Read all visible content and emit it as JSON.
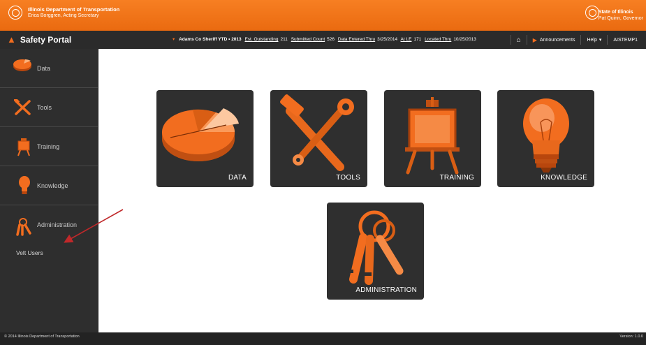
{
  "banner": {
    "org_name": "Illinois Department of Transportation",
    "org_sub": "Erica Borggren, Acting Secretary",
    "state_name": "State of Illinois",
    "state_sub": "Pat Quinn, Governor"
  },
  "navbar": {
    "brand": "Safety Portal",
    "agency": "Adams Co Sheriff YTD • 2013",
    "stats": [
      {
        "label": "Est. Outstanding",
        "value": "211"
      },
      {
        "label": "Submitted Count",
        "value": "526"
      },
      {
        "label": "Data Entered Thru",
        "value": "3/25/2014"
      },
      {
        "label": "At LE",
        "value": "171"
      },
      {
        "label": "Located Thru",
        "value": "10/25/2013"
      }
    ],
    "announcements": "Announcements",
    "help": "Help",
    "user": "AISTEMP1"
  },
  "sidebar": {
    "items": [
      {
        "label": "Data",
        "icon": "pie-chart-icon"
      },
      {
        "label": "Tools",
        "icon": "tools-icon"
      },
      {
        "label": "Training",
        "icon": "easel-icon"
      },
      {
        "label": "Knowledge",
        "icon": "lightbulb-icon"
      },
      {
        "label": "Administration",
        "icon": "keys-icon"
      }
    ],
    "subitem": "Velt Users"
  },
  "tiles": [
    {
      "label": "DATA",
      "icon": "pie-chart-icon"
    },
    {
      "label": "TOOLS",
      "icon": "tools-icon"
    },
    {
      "label": "TRAINING",
      "icon": "easel-icon"
    },
    {
      "label": "KNOWLEDGE",
      "icon": "lightbulb-icon"
    },
    {
      "label": "ADMINISTRATION",
      "icon": "keys-icon"
    }
  ],
  "footer": {
    "copyright": "© 2014 Illinois Department of Transportation",
    "version": "Version: 1.0.0"
  },
  "colors": {
    "accent": "#f26d1f",
    "banner": "#ee7016",
    "dark": "#2e2e2e",
    "annotation": "#c0282a"
  }
}
